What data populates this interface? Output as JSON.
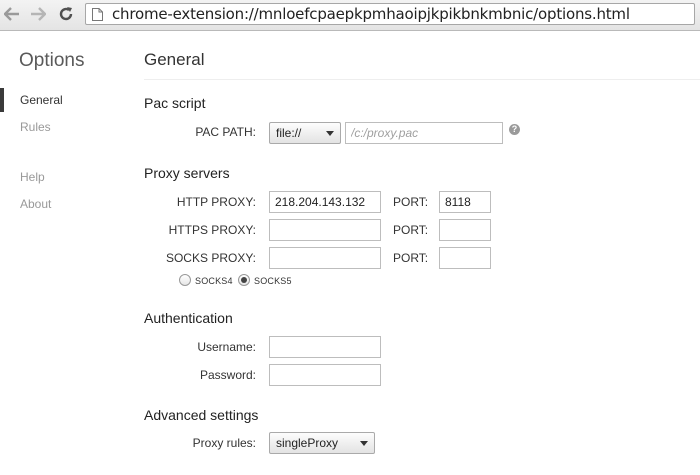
{
  "browser": {
    "url": "chrome-extension://mnloefcpaepkpmhaoipjkpikbnkmbnic/options.html"
  },
  "sidebar": {
    "title": "Options",
    "items": [
      {
        "label": "General"
      },
      {
        "label": "Rules"
      },
      {
        "label": "Help"
      },
      {
        "label": "About"
      }
    ],
    "selected": "General"
  },
  "main": {
    "title": "General",
    "pac": {
      "heading": "Pac script",
      "path_label": "PAC PATH:",
      "protocol_selected": "file://",
      "path_placeholder": "/c:/proxy.pac",
      "path_value": ""
    },
    "proxy": {
      "heading": "Proxy servers",
      "port_label": "PORT:",
      "rows": [
        {
          "label": "HTTP PROXY:",
          "host": "218.204.143.132",
          "port": "8118"
        },
        {
          "label": "HTTPS PROXY:",
          "host": "",
          "port": ""
        },
        {
          "label": "SOCKS PROXY:",
          "host": "",
          "port": ""
        }
      ],
      "socks4_label": "SOCKS4",
      "socks5_label": "SOCKS5",
      "socks_selected": "SOCKS5"
    },
    "auth": {
      "heading": "Authentication",
      "username_label": "Username:",
      "password_label": "Password:",
      "username_value": "",
      "password_value": ""
    },
    "advanced": {
      "heading": "Advanced settings",
      "rules_label": "Proxy rules:",
      "rules_selected": "singleProxy"
    }
  },
  "icons": {
    "back": "arrow-left-icon",
    "forward": "arrow-right-icon",
    "reload": "reload-icon",
    "page": "page-icon",
    "help": "help-icon"
  }
}
